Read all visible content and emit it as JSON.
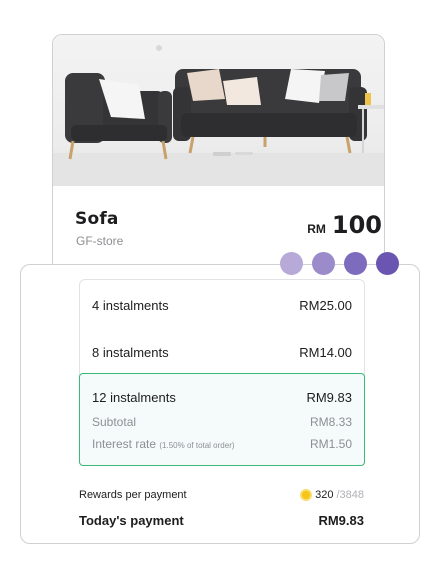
{
  "product": {
    "name": "Sofa",
    "store": "GF-store",
    "currency": "RM",
    "price": "100"
  },
  "dots": {
    "colors": [
      "#b7a9d8",
      "#9c8bcb",
      "#7d6bbd",
      "#6a56b1"
    ]
  },
  "plans": [
    {
      "label": "4 instalments",
      "amount": "RM25.00"
    },
    {
      "label": "8 instalments",
      "amount": "RM14.00"
    }
  ],
  "selected_plan": {
    "label": "12 instalments",
    "amount": "RM9.83",
    "subtotal_label": "Subtotal",
    "subtotal_value": "RM8.33",
    "interest_label": "Interest rate",
    "interest_note": "(1.50% of total order)",
    "interest_value": "RM1.50"
  },
  "rewards": {
    "label": "Rewards per payment",
    "points": "320",
    "total": "/3848",
    "icon": "coin-icon"
  },
  "today": {
    "label": "Today's payment",
    "amount": "RM9.83"
  },
  "colors": {
    "selected_border": "#3cb878",
    "selected_bg": "#f4fbfa",
    "coin": "#f5c518"
  }
}
